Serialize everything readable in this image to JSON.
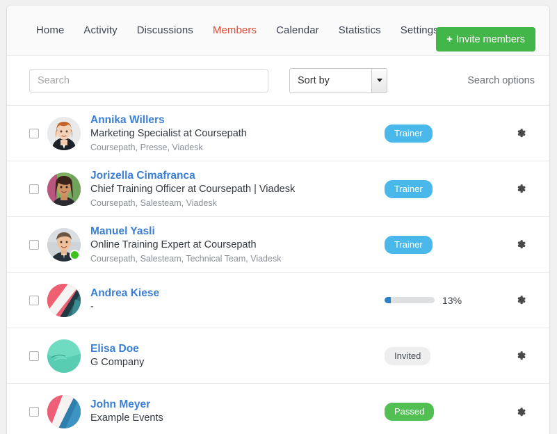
{
  "nav": {
    "items": [
      {
        "label": "Home",
        "active": false,
        "caret": false
      },
      {
        "label": "Activity",
        "active": false,
        "caret": false
      },
      {
        "label": "Discussions",
        "active": false,
        "caret": false
      },
      {
        "label": "Members",
        "active": true,
        "caret": false
      },
      {
        "label": "Calendar",
        "active": false,
        "caret": false
      },
      {
        "label": "Statistics",
        "active": false,
        "caret": false
      },
      {
        "label": "Settings",
        "active": false,
        "caret": true
      }
    ],
    "invite_button": {
      "plus": "+",
      "label": "Invite members"
    }
  },
  "toolbar": {
    "search_placeholder": "Search",
    "search_value": "",
    "sort_by_label": "Sort by",
    "search_options_label": "Search options"
  },
  "members": [
    {
      "name": "Annika Willers",
      "title": "Marketing Specialist at Coursepath",
      "groups": "Coursepath, Presse, Viadesk",
      "status_type": "badge",
      "status_label": "Trainer",
      "badge_style": "trainer",
      "online": false,
      "avatar_kind": "photo-annika"
    },
    {
      "name": "Jorizella Cimafranca",
      "title": "Chief Training Officer at Coursepath | Viadesk",
      "groups": "Coursepath, Salesteam, Viadesk",
      "status_type": "badge",
      "status_label": "Trainer",
      "badge_style": "trainer",
      "online": false,
      "avatar_kind": "photo-jorizella"
    },
    {
      "name": "Manuel Yasli",
      "title": "Online Training Expert at Coursepath",
      "groups": "Coursepath, Salesteam, Technical Team, Viadesk",
      "status_type": "badge",
      "status_label": "Trainer",
      "badge_style": "trainer",
      "online": true,
      "avatar_kind": "photo-manuel"
    },
    {
      "name": "Andrea Kiese",
      "title": "-",
      "groups": "",
      "status_type": "progress",
      "status_label": "13%",
      "progress_percent": 13,
      "online": false,
      "avatar_kind": "abstract-red"
    },
    {
      "name": "Elisa Doe",
      "title": "G Company",
      "groups": "",
      "status_type": "badge",
      "status_label": "Invited",
      "badge_style": "invited",
      "online": false,
      "avatar_kind": "abstract-mint"
    },
    {
      "name": "John Meyer",
      "title": "Example Events",
      "groups": "",
      "status_type": "badge",
      "status_label": "Passed",
      "badge_style": "passed",
      "online": false,
      "avatar_kind": "abstract-blue"
    }
  ],
  "icons": {
    "gear": "gear-icon",
    "caret": "chevron-down-icon"
  },
  "colors": {
    "accent_active_nav": "#e8482f",
    "invite_green": "#42b649",
    "link_blue": "#3b7fd4",
    "badge_trainer": "#4ab8ea",
    "badge_passed": "#52bf52",
    "badge_invited": "#eeeeee",
    "progress_fill": "#2a7fc9",
    "online_dot": "#3fc21f"
  }
}
